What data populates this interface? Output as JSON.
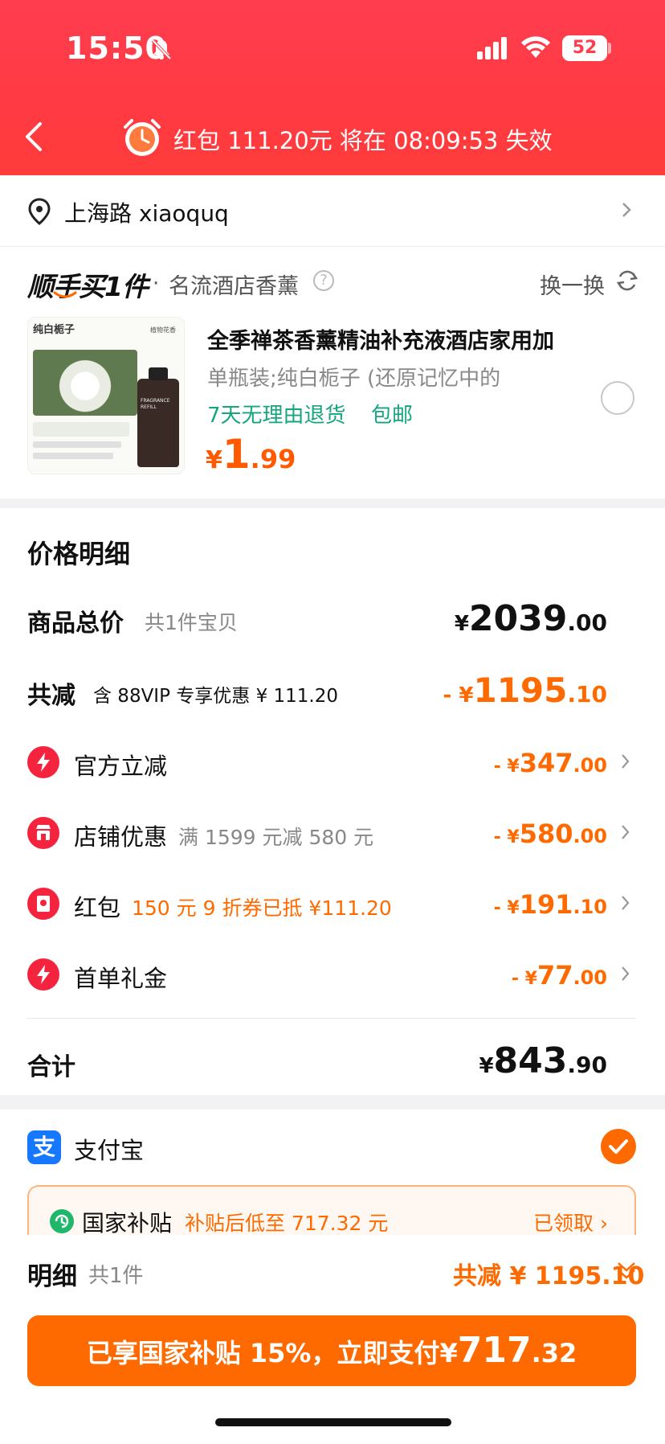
{
  "status": {
    "time": "15:50",
    "battery": "52"
  },
  "header": {
    "countdown": "红包 111.20元 将在 08:09:53 失效"
  },
  "address": {
    "text": "上海路 xiaoquq"
  },
  "addon": {
    "brand": "顺手买1件",
    "dot": "·",
    "subtitle": "名流酒店香薰",
    "help": "?",
    "swap": "换一换",
    "product": {
      "title": "全季禅茶香薰精油补充液酒店家用加",
      "spec": "单瓶装;纯白栀子 (还原记忆中的",
      "tag1": "7天无理由退货",
      "tag2": "包邮",
      "price_symbol": "¥",
      "price_int": "1",
      "price_dec": ".99",
      "image_text": {
        "top_left": "纯白栀子",
        "top_right": "植物花香",
        "bottle": "FRAGRANCE REFILL"
      }
    }
  },
  "price_detail": {
    "title": "价格明细",
    "goods_total": {
      "label": "商品总价",
      "sub": "共1件宝贝",
      "symbol": "¥",
      "int": "2039",
      "dec": ".00"
    },
    "total_discount": {
      "label": "共减",
      "sub": "含 88VIP 专享优惠 ¥ 111.20",
      "prefix": "- ¥",
      "int": "1195",
      "dec": ".10"
    },
    "items": [
      {
        "name": "官方立减",
        "sub": "",
        "prefix": "- ¥",
        "int": "347",
        "dec": ".00",
        "icon": "lightning-icon"
      },
      {
        "name": "店铺优惠",
        "sub": "满 1599 元减 580 元",
        "prefix": "- ¥",
        "int": "580",
        "dec": ".00",
        "icon": "shop-icon"
      },
      {
        "name": "红包",
        "sub": "150 元 9 折券已抵 ¥111.20",
        "prefix": "- ¥",
        "int": "191",
        "dec": ".10",
        "icon": "red-packet-icon"
      },
      {
        "name": "首单礼金",
        "sub": "",
        "prefix": "- ¥",
        "int": "77",
        "dec": ".00",
        "icon": "lightning-icon"
      }
    ],
    "sum": {
      "label": "合计",
      "symbol": "¥",
      "int": "843",
      "dec": ".90"
    }
  },
  "payment": {
    "method": "支付宝",
    "method_icon": "支",
    "subsidy": {
      "label": "国家补贴",
      "sub": "补贴后低至 717.32 元",
      "claimed": "已领取 ›"
    }
  },
  "footer": {
    "detail_label": "明细",
    "detail_count": "共1件",
    "detail_total": "共减 ¥ 1195.10",
    "pay_text": "已享国家补贴 15%，立即支付",
    "pay_symbol": "¥",
    "pay_int": "717",
    "pay_dec": ".32"
  },
  "colors": {
    "header_red": "#ff3d4f",
    "accent_orange": "#ff6a00",
    "green": "#16a57f",
    "alipay_blue": "#1677ff"
  }
}
